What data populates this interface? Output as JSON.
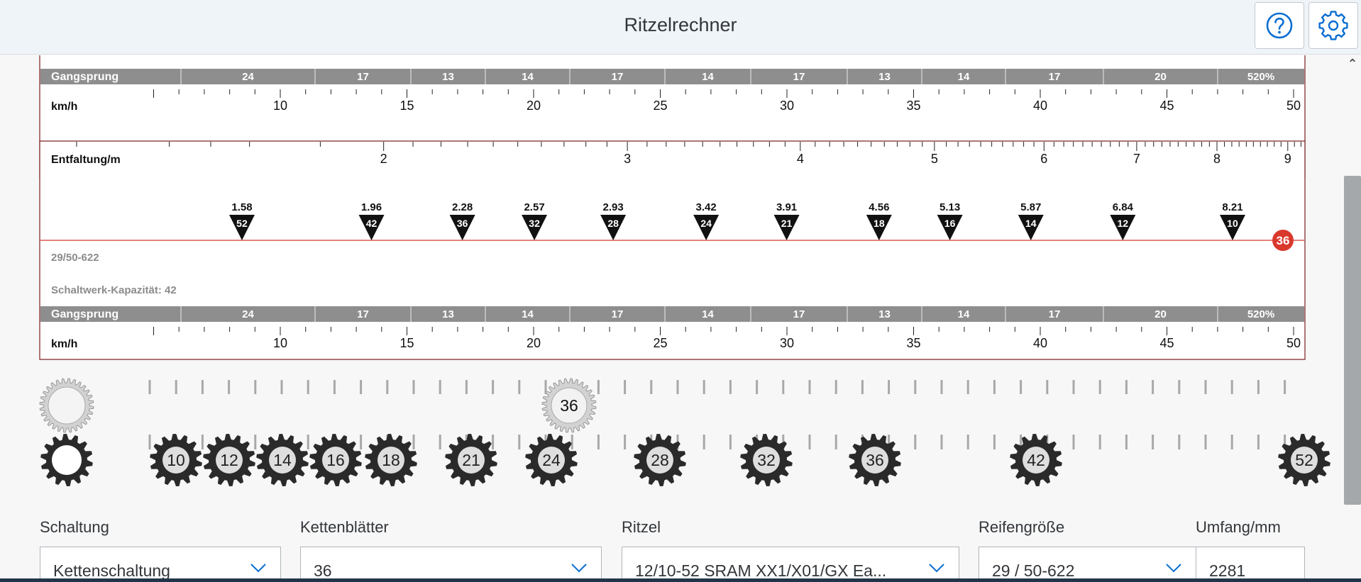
{
  "app": {
    "title": "Ritzelrechner"
  },
  "header": {
    "help_icon": "help-icon",
    "settings_icon": "gear-icon"
  },
  "colors": {
    "accent_red": "#d9382d",
    "gangsprung_bar": "#8e8e8e",
    "cog_dark": "#2a2a2a",
    "chainring_grey": "#c8c8c8"
  },
  "top_panel": {
    "kapazitaet_label": "Schaltwerk-Kapazität: 42",
    "gangsprung_label": "Gangsprung",
    "gangsprung_values": [
      "24",
      "17",
      "13",
      "14",
      "17",
      "14",
      "17",
      "13",
      "14",
      "17",
      "20",
      "520%"
    ],
    "kmh_label": "km/h",
    "kmh_ticks": [
      "10",
      "15",
      "20",
      "25",
      "30",
      "35",
      "40",
      "45",
      "50"
    ]
  },
  "main_panel": {
    "entfaltung_label": "Entfaltung/m",
    "entfaltung_ticks": [
      "2",
      "3",
      "4",
      "5",
      "6",
      "7",
      "8",
      "9"
    ],
    "markers": [
      {
        "development": "1.58",
        "cog": "52"
      },
      {
        "development": "1.96",
        "cog": "42"
      },
      {
        "development": "2.28",
        "cog": "36"
      },
      {
        "development": "2.57",
        "cog": "32"
      },
      {
        "development": "2.93",
        "cog": "28"
      },
      {
        "development": "3.42",
        "cog": "24"
      },
      {
        "development": "3.91",
        "cog": "21"
      },
      {
        "development": "4.56",
        "cog": "18"
      },
      {
        "development": "5.13",
        "cog": "16"
      },
      {
        "development": "5.87",
        "cog": "14"
      },
      {
        "development": "6.84",
        "cog": "12"
      },
      {
        "development": "8.21",
        "cog": "10"
      }
    ],
    "chainring_badge": "36",
    "wheel_label": "29/50-622",
    "kapazitaet_label": "Schaltwerk-Kapazität: 42",
    "gangsprung_label": "Gangsprung",
    "gangsprung_values": [
      "24",
      "17",
      "13",
      "14",
      "17",
      "14",
      "17",
      "13",
      "14",
      "17",
      "20",
      "520%"
    ],
    "kmh_label": "km/h",
    "kmh_ticks": [
      "10",
      "15",
      "20",
      "25",
      "30",
      "35",
      "40",
      "45",
      "50"
    ]
  },
  "drivetrain": {
    "chainrings": [
      "36"
    ],
    "cassette": [
      "10",
      "12",
      "14",
      "16",
      "18",
      "21",
      "24",
      "28",
      "32",
      "36",
      "42",
      "52"
    ]
  },
  "form": {
    "schaltung": {
      "label": "Schaltung",
      "value": "Kettenschaltung"
    },
    "kettenblaetter": {
      "label": "Kettenblätter",
      "value": "36"
    },
    "ritzel": {
      "label": "Ritzel",
      "value": "12/10-52 SRAM XX1/X01/GX Ea..."
    },
    "reifengroesse": {
      "label": "Reifengröße",
      "value": "29 / 50-622"
    },
    "umfang": {
      "label": "Umfang/mm",
      "value": "2281"
    }
  }
}
